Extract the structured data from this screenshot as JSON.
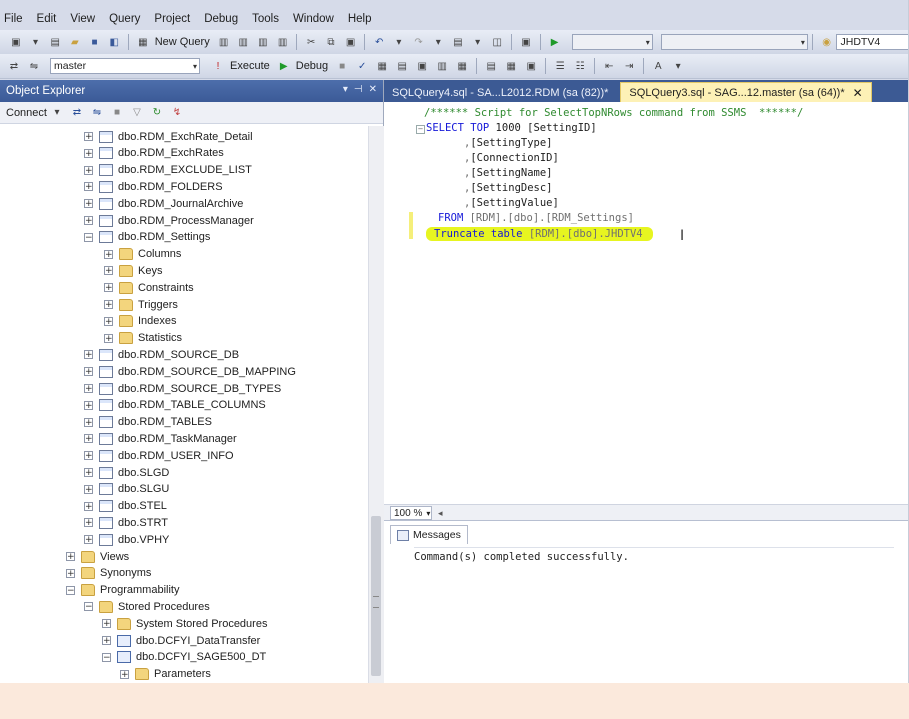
{
  "menu": [
    "File",
    "Edit",
    "View",
    "Query",
    "Project",
    "Debug",
    "Tools",
    "Window",
    "Help"
  ],
  "toolbar1": {
    "new_query": "New Query",
    "server_combo": "JHDTV4"
  },
  "toolbar2": {
    "database": "master",
    "execute": "Execute",
    "debug": "Debug"
  },
  "object_explorer": {
    "title": "Object Explorer",
    "connect": "Connect",
    "nodes": [
      {
        "label": "dbo.RDM_ExchRate_Detail",
        "icon": "table-icon",
        "expander": "+"
      },
      {
        "label": "dbo.RDM_ExchRates",
        "icon": "table-icon",
        "expander": "+"
      },
      {
        "label": "dbo.RDM_EXCLUDE_LIST",
        "icon": "table-icon",
        "expander": "+"
      },
      {
        "label": "dbo.RDM_FOLDERS",
        "icon": "table-icon",
        "expander": "+"
      },
      {
        "label": "dbo.RDM_JournalArchive",
        "icon": "table-icon",
        "expander": "+"
      },
      {
        "label": "dbo.RDM_ProcessManager",
        "icon": "table-icon",
        "expander": "+"
      },
      {
        "label": "dbo.RDM_Settings",
        "icon": "table-icon",
        "expander": "−"
      },
      {
        "label": "Columns",
        "icon": "folder-icon",
        "expander": "+"
      },
      {
        "label": "Keys",
        "icon": "folder-icon",
        "expander": "+"
      },
      {
        "label": "Constraints",
        "icon": "folder-icon",
        "expander": "+"
      },
      {
        "label": "Triggers",
        "icon": "folder-icon",
        "expander": "+"
      },
      {
        "label": "Indexes",
        "icon": "folder-icon",
        "expander": "+"
      },
      {
        "label": "Statistics",
        "icon": "folder-icon",
        "expander": "+"
      },
      {
        "label": "dbo.RDM_SOURCE_DB",
        "icon": "table-icon",
        "expander": "+"
      },
      {
        "label": "dbo.RDM_SOURCE_DB_MAPPING",
        "icon": "table-icon",
        "expander": "+"
      },
      {
        "label": "dbo.RDM_SOURCE_DB_TYPES",
        "icon": "table-icon",
        "expander": "+"
      },
      {
        "label": "dbo.RDM_TABLE_COLUMNS",
        "icon": "table-icon",
        "expander": "+"
      },
      {
        "label": "dbo.RDM_TABLES",
        "icon": "table-icon",
        "expander": "+"
      },
      {
        "label": "dbo.RDM_TaskManager",
        "icon": "table-icon",
        "expander": "+"
      },
      {
        "label": "dbo.RDM_USER_INFO",
        "icon": "table-icon",
        "expander": "+"
      },
      {
        "label": "dbo.SLGD",
        "icon": "table-icon",
        "expander": "+"
      },
      {
        "label": "dbo.SLGU",
        "icon": "table-icon",
        "expander": "+"
      },
      {
        "label": "dbo.STEL",
        "icon": "table-icon",
        "expander": "+"
      },
      {
        "label": "dbo.STRT",
        "icon": "table-icon",
        "expander": "+"
      },
      {
        "label": "dbo.VPHY",
        "icon": "table-icon",
        "expander": "+"
      },
      {
        "label": "Views",
        "icon": "folder-icon",
        "expander": "+"
      },
      {
        "label": "Synonyms",
        "icon": "folder-icon",
        "expander": "+"
      },
      {
        "label": "Programmability",
        "icon": "folder-icon",
        "expander": "−"
      },
      {
        "label": "Stored Procedures",
        "icon": "folder-icon",
        "expander": "−"
      },
      {
        "label": "System Stored Procedures",
        "icon": "folder-icon",
        "expander": "+"
      },
      {
        "label": "dbo.DCFYI_DataTransfer",
        "icon": "proc-icon",
        "expander": "+"
      },
      {
        "label": "dbo.DCFYI_SAGE500_DT",
        "icon": "proc-icon",
        "expander": "−"
      },
      {
        "label": "Parameters",
        "icon": "folder-icon",
        "expander": "+"
      }
    ]
  },
  "tabs": [
    {
      "label": "SQLQuery4.sql - SA...L2012.RDM (sa (82))*",
      "active": false
    },
    {
      "label": "SQLQuery3.sql - SAG...12.master (sa (64))*",
      "active": true
    }
  ],
  "editor": {
    "comment": "/****** Script for SelectTopNRows command from SSMS  ******/",
    "select_kw": "SELECT TOP ",
    "top_n": "1000",
    "first_col": " [SettingID]",
    "cols": [
      ",[SettingType]",
      ",[ConnectionID]",
      ",[SettingName]",
      ",[SettingDesc]",
      ",[SettingValue]"
    ],
    "from_kw": "FROM ",
    "from_obj": "[RDM].[dbo].[RDM_Settings]",
    "truncate_kw": "Truncate table ",
    "truncate_obj": "[RDM].[dbo].JHDTV4",
    "highlight_color": "#e7f520"
  },
  "zoom": "100 %",
  "results": {
    "tab": "Messages",
    "message": "Command(s) completed successfully."
  }
}
